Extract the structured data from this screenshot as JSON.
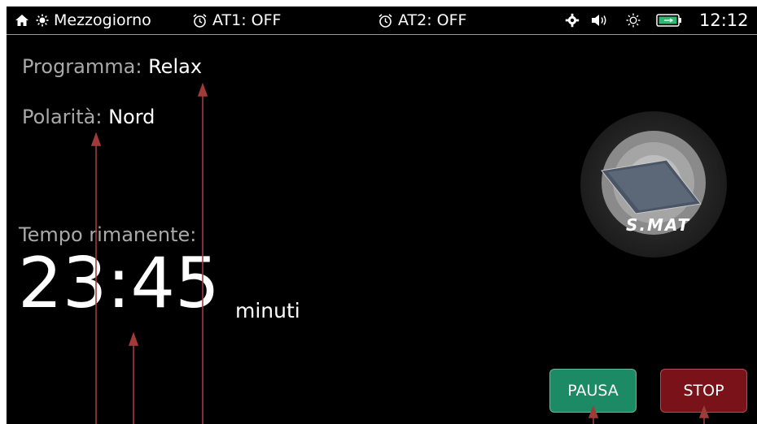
{
  "status_bar": {
    "mode_label": "Mezzogiorno",
    "alarm1": "AT1: OFF",
    "alarm2": "AT2: OFF",
    "clock": "12:12",
    "icons": [
      "home-icon",
      "sun-icon",
      "alarm-clock-icon",
      "gear-icon",
      "speaker-icon",
      "brightness-icon",
      "battery-icon"
    ]
  },
  "program": {
    "label": "Programma:",
    "value": "Relax"
  },
  "polarity": {
    "label": "Polarità:",
    "value": "Nord"
  },
  "timer": {
    "label": "Tempo rimanente:",
    "value": "23:45",
    "unit": "minuti"
  },
  "device": {
    "logo_text": "S.MAT"
  },
  "buttons": {
    "pause": "PAUSA",
    "stop": "STOP"
  },
  "colors": {
    "pause_button": "#1c8a64",
    "stop_button": "#7a1219",
    "annotation_arrow": "#a23a3a",
    "label_gray": "#a9a9a9"
  }
}
